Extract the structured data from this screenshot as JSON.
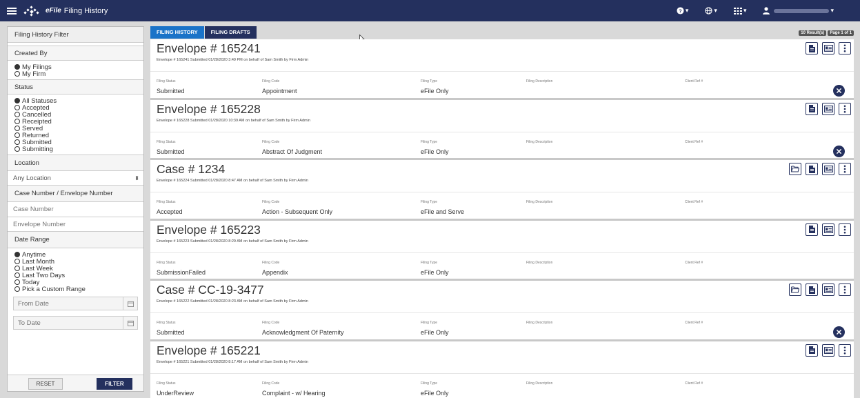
{
  "header": {
    "brand": "eFile",
    "title": "Filing History",
    "help_icon": "question-circle-icon",
    "globe_icon": "globe-icon",
    "grid_icon": "grid-icon",
    "user_icon": "user-icon",
    "colors": {
      "bar": "#24305e",
      "accent": "#1a73c8"
    }
  },
  "sidebar": {
    "title": "Filing History Filter",
    "created_by": {
      "title": "Created By",
      "options": [
        {
          "label": "My Filings",
          "selected": true
        },
        {
          "label": "My Firm",
          "selected": false
        }
      ]
    },
    "status": {
      "title": "Status",
      "options": [
        {
          "label": "All Statuses",
          "selected": true
        },
        {
          "label": "Accepted",
          "selected": false
        },
        {
          "label": "Cancelled",
          "selected": false
        },
        {
          "label": "Receipted",
          "selected": false
        },
        {
          "label": "Served",
          "selected": false
        },
        {
          "label": "Returned",
          "selected": false
        },
        {
          "label": "Submitted",
          "selected": false
        },
        {
          "label": "Submitting",
          "selected": false
        }
      ]
    },
    "location": {
      "title": "Location",
      "value": "Any Location"
    },
    "numbers": {
      "title": "Case Number   /   Envelope Number",
      "case_placeholder": "Case Number",
      "envelope_placeholder": "Envelope Number"
    },
    "date_range": {
      "title": "Date Range",
      "options": [
        {
          "label": "Anytime",
          "selected": true
        },
        {
          "label": "Last Month",
          "selected": false
        },
        {
          "label": "Last Week",
          "selected": false
        },
        {
          "label": "Last Two Days",
          "selected": false
        },
        {
          "label": "Today",
          "selected": false
        },
        {
          "label": "Pick a Custom Range",
          "selected": false
        }
      ],
      "from_placeholder": "From Date",
      "to_placeholder": "To Date"
    },
    "reset_label": "RESET",
    "filter_label": "FILTER"
  },
  "tabs": [
    {
      "label": "FILING HISTORY",
      "active": true
    },
    {
      "label": "FILING DRAFTS",
      "active": false
    }
  ],
  "results": {
    "count": "10 Result(s)",
    "page": "Page 1 of 1"
  },
  "field_labels": {
    "status": "Filing Status",
    "code": "Filing Code",
    "type": "Filing Type",
    "description": "Filing Description",
    "client_ref": "Client Ref #"
  },
  "filings": [
    {
      "title": "Envelope # 165241",
      "subtitle": "Envelope # 165241 Submitted 01/28/2020 3:49 PM on behalf of Sam Smith by Firm Admin",
      "status": "Submitted",
      "code": "Appointment",
      "type": "eFile Only",
      "description": "",
      "client_ref": "",
      "case_icon": false,
      "cancel": true
    },
    {
      "title": "Envelope # 165228",
      "subtitle": "Envelope # 165228 Submitted 01/28/2020 10:39 AM on behalf of Sam Smith by Firm Admin",
      "status": "Submitted",
      "code": "Abstract Of Judgment",
      "type": "eFile Only",
      "description": "",
      "client_ref": "",
      "case_icon": false,
      "cancel": true
    },
    {
      "title": "Case # 1234",
      "subtitle": "Envelope # 165224 Submitted 01/28/2020 8:47 AM on behalf of Sam Smith by Firm Admin",
      "status": "Accepted",
      "code": "Action - Subsequent Only",
      "type": "eFile and Serve",
      "description": "",
      "client_ref": "",
      "case_icon": true,
      "cancel": false
    },
    {
      "title": "Envelope # 165223",
      "subtitle": "Envelope # 165223 Submitted 01/28/2020 8:29 AM on behalf of Sam Smith by Firm Admin",
      "status": "SubmissionFailed",
      "code": "Appendix",
      "type": "eFile Only",
      "description": "",
      "client_ref": "",
      "case_icon": false,
      "cancel": false
    },
    {
      "title": "Case # CC-19-3477",
      "subtitle": "Envelope # 165222 Submitted 01/28/2020 8:23 AM on behalf of Sam Smith by Firm Admin",
      "status": "Submitted",
      "code": "Acknowledgment Of Paternity",
      "type": "eFile Only",
      "description": "",
      "client_ref": "",
      "case_icon": true,
      "cancel": true
    },
    {
      "title": "Envelope # 165221",
      "subtitle": "Envelope # 165221 Submitted 01/28/2020 8:17 AM on behalf of Sam Smith by Firm Admin",
      "status": "UnderReview",
      "code": "Complaint - w/ Hearing",
      "type": "eFile Only",
      "description": "",
      "client_ref": "",
      "case_icon": false,
      "cancel": false
    }
  ]
}
